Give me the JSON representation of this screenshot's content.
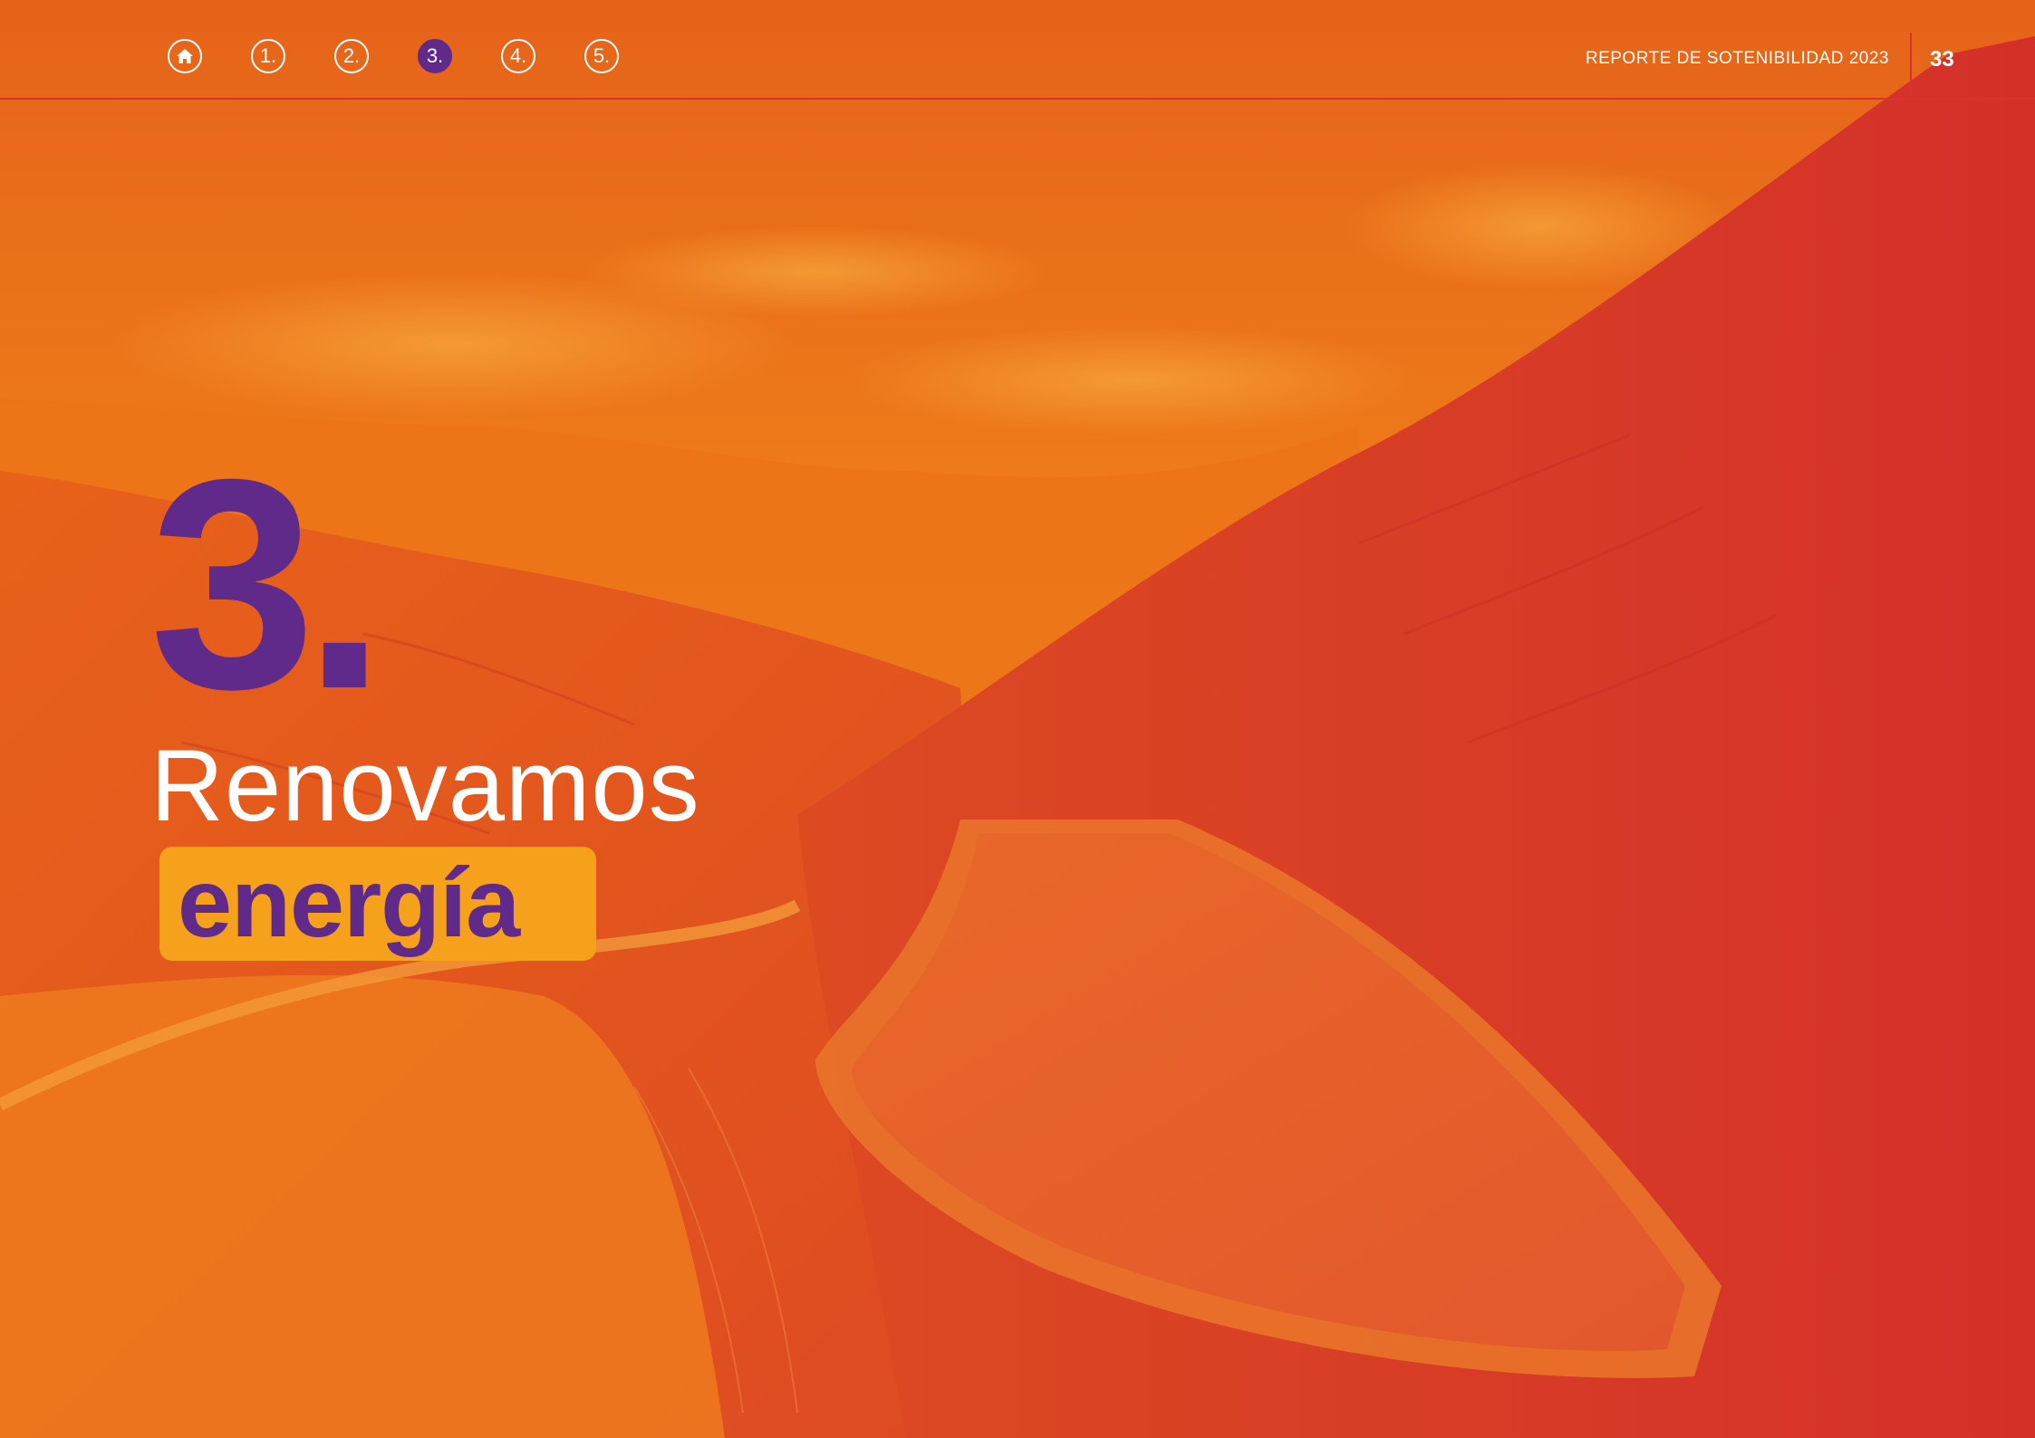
{
  "header": {
    "nav": [
      {
        "label": "",
        "icon": "home-icon",
        "active": false
      },
      {
        "label": "1.",
        "active": false
      },
      {
        "label": "2.",
        "active": false
      },
      {
        "label": "3.",
        "active": true
      },
      {
        "label": "4.",
        "active": false
      },
      {
        "label": "5.",
        "active": false
      }
    ],
    "report_title": "REPORTE DE SOTENIBILIDAD 2023",
    "page_number": "33"
  },
  "section": {
    "number": "3.",
    "title_line1": "Renovamos",
    "title_line2": "energía"
  },
  "colors": {
    "background_orange": "#e85d10",
    "sky_orange": "#f08318",
    "mountain_red": "#d9342b",
    "purple": "#5f2a8a",
    "highlight_yellow": "#f5a11b",
    "white": "#ffffff"
  }
}
